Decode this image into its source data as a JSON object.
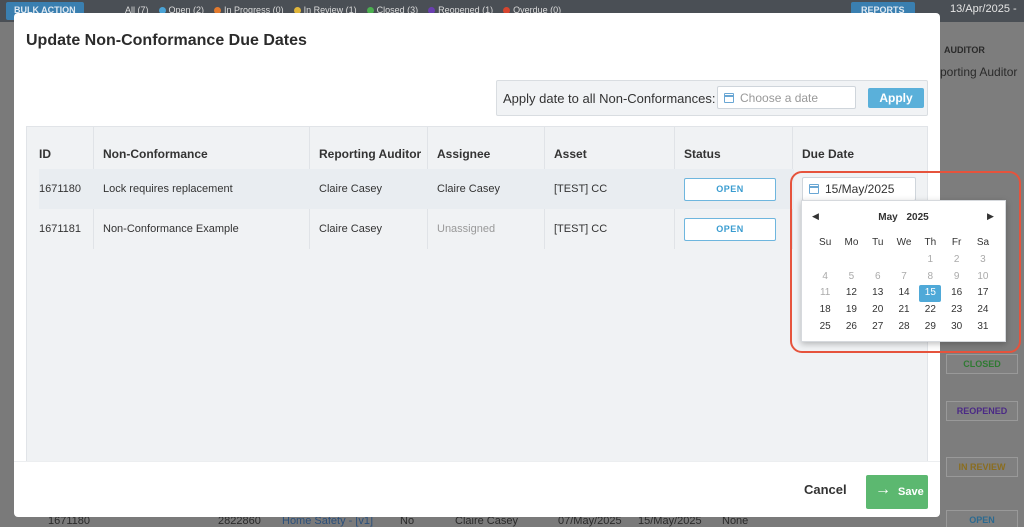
{
  "background": {
    "bulk_action": "BULK ACTION",
    "filters": [
      {
        "label": "All (7)",
        "color": "#ffffff"
      },
      {
        "label": "Open (2)",
        "color": "#4aa3d6"
      },
      {
        "label": "In Progress (0)",
        "color": "#e27a2e"
      },
      {
        "label": "In Review (1)",
        "color": "#e0b53a"
      },
      {
        "label": "Closed (3)",
        "color": "#4caf50"
      },
      {
        "label": "Reopened (1)",
        "color": "#6a3fb0"
      },
      {
        "label": "Overdue (0)",
        "color": "#d6452f"
      }
    ],
    "reports": "REPORTS",
    "date": "13/Apr/2025 -",
    "auditor_header": "AUDITOR",
    "auditor_value": "porting Auditor",
    "badges": [
      "CLOSED",
      "REOPENED",
      "IN REVIEW",
      "OPEN"
    ],
    "bottom_row": [
      "1671180",
      "2822860",
      "Home Safety - [v1]",
      "No",
      "Claire Casey",
      "07/May/2025",
      "15/May/2025",
      "None"
    ]
  },
  "modal": {
    "title": "Update Non-Conformance Due Dates",
    "apply_label": "Apply date to all Non-Conformances:",
    "date_placeholder": "Choose a date",
    "apply_button": "Apply",
    "columns": [
      "ID",
      "Non-Conformance",
      "Reporting Auditor",
      "Assignee",
      "Asset",
      "Status",
      "Due Date"
    ],
    "rows": [
      {
        "id": "1671180",
        "nc": "Lock requires replacement",
        "auditor": "Claire Casey",
        "assignee": "Claire Casey",
        "asset": "[TEST] CC",
        "status": "OPEN",
        "due": "15/May/2025"
      },
      {
        "id": "1671181",
        "nc": "Non-Conformance Example",
        "auditor": "Claire Casey",
        "assignee": "Unassigned",
        "asset": "[TEST] CC",
        "status": "OPEN",
        "due": ""
      }
    ],
    "cancel": "Cancel",
    "save": "Save"
  },
  "calendar": {
    "month": "May",
    "year": "2025",
    "prev": "◀",
    "next": "▶",
    "weekdays": [
      "Su",
      "Mo",
      "Tu",
      "We",
      "Th",
      "Fr",
      "Sa"
    ],
    "weeks": [
      [
        "",
        "",
        "",
        "",
        "1",
        "2",
        "3"
      ],
      [
        "4",
        "5",
        "6",
        "7",
        "8",
        "9",
        "10"
      ],
      [
        "11",
        "12",
        "13",
        "14",
        "15",
        "16",
        "17"
      ],
      [
        "18",
        "19",
        "20",
        "21",
        "22",
        "23",
        "24"
      ],
      [
        "25",
        "26",
        "27",
        "28",
        "29",
        "30",
        "31"
      ]
    ],
    "disabled_through": 11,
    "selected": "15"
  },
  "colors": {
    "accent": "#4fa9d8",
    "save": "#5cb870",
    "highlight": "#e6533c"
  }
}
